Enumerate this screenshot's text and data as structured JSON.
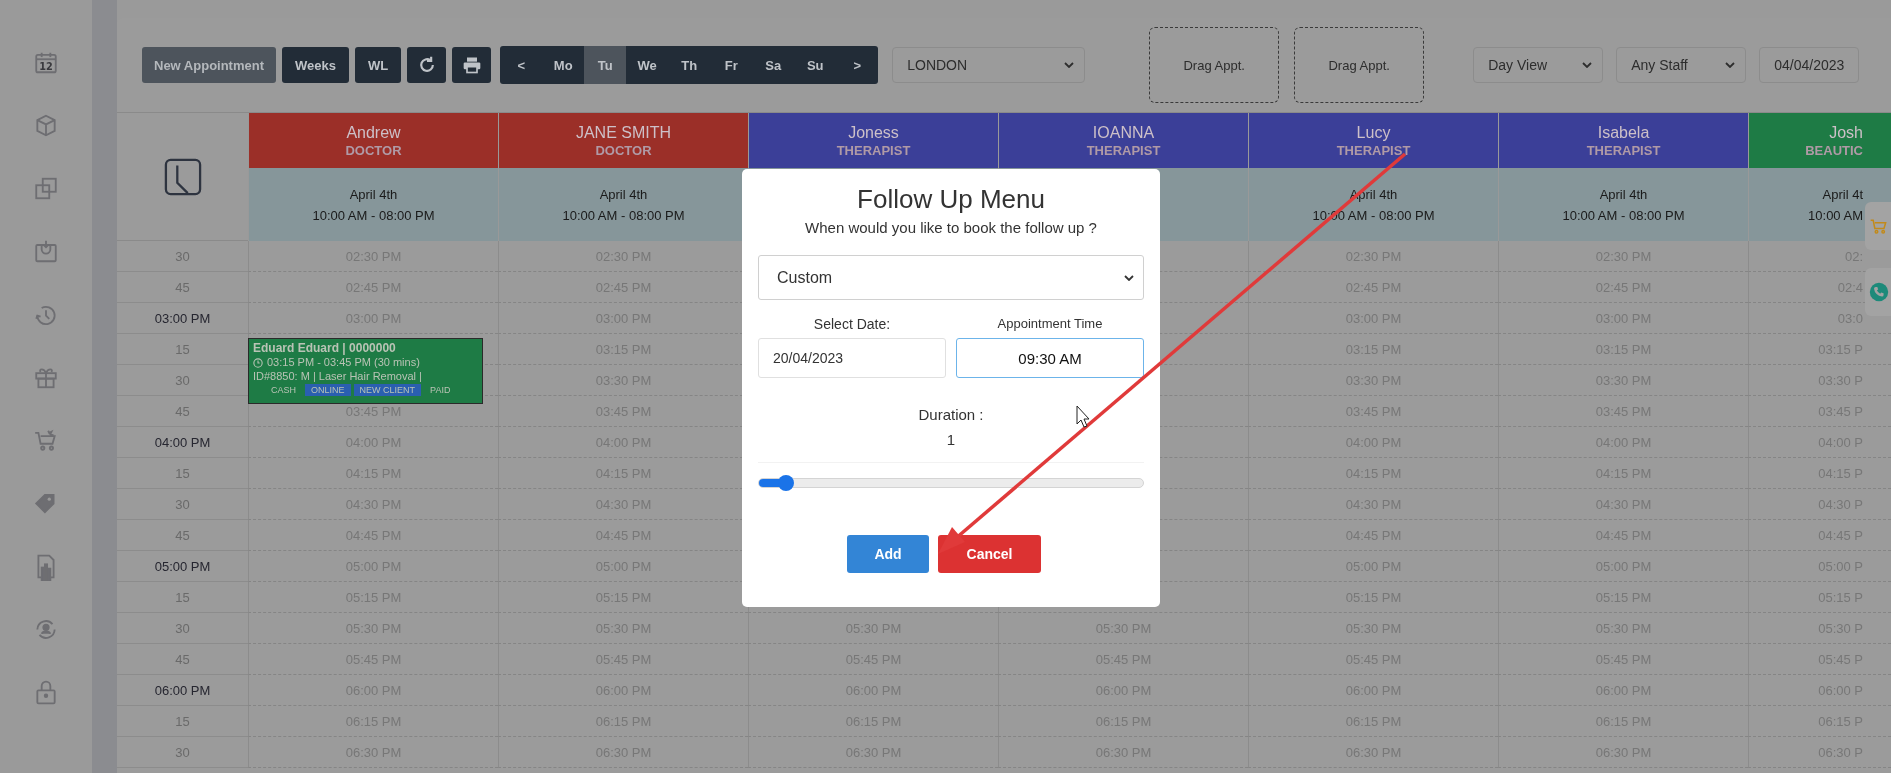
{
  "sidebar": {
    "calendar_day": "12"
  },
  "toolbar": {
    "buttons": [
      {
        "label": "New Appointment",
        "kind": "primary"
      },
      {
        "label": "Weeks",
        "kind": "dark"
      },
      {
        "label": "WL",
        "kind": "dark"
      },
      {
        "kind": "refresh"
      },
      {
        "kind": "print"
      }
    ],
    "day_nav": [
      {
        "label": "<",
        "selected": false
      },
      {
        "label": "Mo",
        "selected": false
      },
      {
        "label": "Tu",
        "selected": true
      },
      {
        "label": "We",
        "selected": false
      },
      {
        "label": "Th",
        "selected": false
      },
      {
        "label": "Fr",
        "selected": false
      },
      {
        "label": "Sa",
        "selected": false
      },
      {
        "label": "Su",
        "selected": false
      },
      {
        "label": ">",
        "selected": false
      }
    ],
    "location": {
      "value": "LONDON"
    },
    "drag_slots": [
      "Drag Appt.",
      "Drag Appt."
    ],
    "view_select": {
      "value": "Day View"
    },
    "staff_select": {
      "value": "Any Staff"
    },
    "date_field": {
      "value": "04/04/2023"
    }
  },
  "schedule": {
    "staff": [
      {
        "name": "Andrew",
        "role": "DOCTOR",
        "color": "#9b2f28",
        "date": "April 4th",
        "hours": "10:00 AM - 08:00 PM"
      },
      {
        "name": "JANE SMITH",
        "role": "DOCTOR",
        "color": "#9b2f28",
        "date": "April 4th",
        "hours": "10:00 AM - 08:00 PM"
      },
      {
        "name": "Joness",
        "role": "THERAPIST",
        "color": "#3b3f98"
      },
      {
        "name": "IOANNA",
        "role": "THERAPIST",
        "color": "#3b3f98"
      },
      {
        "name": "Lucy",
        "role": "THERAPIST",
        "color": "#3b3f98",
        "date": "April 4th",
        "hours": "10:00 AM - 08:00 PM"
      },
      {
        "name": "Isabela",
        "role": "THERAPIST",
        "color": "#3b3f98",
        "date": "April 4th",
        "hours": "10:00 AM - 08:00 PM"
      },
      {
        "name": "Josh",
        "role": "BEAUTIC",
        "color": "#1e7b45",
        "date": "April 4t",
        "hours": "10:00 AM"
      }
    ],
    "rows": [
      {
        "label": "30",
        "kind": "quarter",
        "cells": [
          "02:30 PM",
          "02:30 PM",
          null,
          null,
          "02:30 PM",
          "02:30 PM",
          "02:"
        ]
      },
      {
        "label": "45",
        "kind": "quarter",
        "cells": [
          "02:45 PM",
          "02:45 PM",
          null,
          null,
          "02:45 PM",
          "02:45 PM",
          "02:4"
        ]
      },
      {
        "label": "03:00 PM",
        "kind": "hour",
        "cells": [
          "03:00 PM",
          "03:00 PM",
          null,
          null,
          "03:00 PM",
          "03:00 PM",
          "03:0"
        ]
      },
      {
        "label": "15",
        "kind": "quarter",
        "cells": [
          null,
          "03:15 PM",
          null,
          null,
          "03:15 PM",
          "03:15 PM",
          "03:15 P"
        ]
      },
      {
        "label": "30",
        "kind": "quarter",
        "cells": [
          null,
          "03:30 PM",
          null,
          null,
          "03:30 PM",
          "03:30 PM",
          "03:30 P"
        ]
      },
      {
        "label": "45",
        "kind": "quarter",
        "cells": [
          "03:45 PM",
          "03:45 PM",
          null,
          null,
          "03:45 PM",
          "03:45 PM",
          "03:45 P"
        ]
      },
      {
        "label": "04:00 PM",
        "kind": "hour",
        "cells": [
          "04:00 PM",
          "04:00 PM",
          null,
          null,
          "04:00 PM",
          "04:00 PM",
          "04:00 P"
        ]
      },
      {
        "label": "15",
        "kind": "quarter",
        "cells": [
          "04:15 PM",
          "04:15 PM",
          null,
          null,
          "04:15 PM",
          "04:15 PM",
          "04:15 P"
        ]
      },
      {
        "label": "30",
        "kind": "quarter",
        "cells": [
          "04:30 PM",
          "04:30 PM",
          null,
          null,
          "04:30 PM",
          "04:30 PM",
          "04:30 P"
        ]
      },
      {
        "label": "45",
        "kind": "quarter",
        "cells": [
          "04:45 PM",
          "04:45 PM",
          null,
          null,
          "04:45 PM",
          "04:45 PM",
          "04:45 P"
        ]
      },
      {
        "label": "05:00 PM",
        "kind": "hour",
        "cells": [
          "05:00 PM",
          "05:00 PM",
          null,
          null,
          "05:00 PM",
          "05:00 PM",
          "05:00 P"
        ]
      },
      {
        "label": "15",
        "kind": "quarter",
        "cells": [
          "05:15 PM",
          "05:15 PM",
          null,
          null,
          "05:15 PM",
          "05:15 PM",
          "05:15 P"
        ]
      },
      {
        "label": "30",
        "kind": "quarter",
        "cells": [
          "05:30 PM",
          "05:30 PM",
          "05:30 PM",
          "05:30 PM",
          "05:30 PM",
          "05:30 PM",
          "05:30 P"
        ]
      },
      {
        "label": "45",
        "kind": "quarter",
        "cells": [
          "05:45 PM",
          "05:45 PM",
          "05:45 PM",
          "05:45 PM",
          "05:45 PM",
          "05:45 PM",
          "05:45 P"
        ]
      },
      {
        "label": "06:00 PM",
        "kind": "hour",
        "cells": [
          "06:00 PM",
          "06:00 PM",
          "06:00 PM",
          "06:00 PM",
          "06:00 PM",
          "06:00 PM",
          "06:00 P"
        ]
      },
      {
        "label": "15",
        "kind": "quarter",
        "cells": [
          "06:15 PM",
          "06:15 PM",
          "06:15 PM",
          "06:15 PM",
          "06:15 PM",
          "06:15 PM",
          "06:15 P"
        ]
      },
      {
        "label": "30",
        "kind": "quarter",
        "cells": [
          "06:30 PM",
          "06:30 PM",
          "06:30 PM",
          "06:30 PM",
          "06:30 PM",
          "06:30 PM",
          "06:30 P"
        ]
      }
    ],
    "appointment": {
      "title": "Eduard Eduard | 0000000",
      "time": "03:15 PM - 03:45 PM (30 mins)",
      "details": "ID#8850: M | Laser Hair Removal |",
      "tags": [
        {
          "label": "CASH",
          "color": "#1e7b45"
        },
        {
          "label": "ONLINE",
          "color": "#2a5fb0"
        },
        {
          "label": "NEW CLIENT",
          "color": "#2a5fb0"
        },
        {
          "label": "PAID",
          "color": "#1e7b45"
        }
      ]
    }
  },
  "modal": {
    "title": "Follow Up Menu",
    "prompt": "When would you like to book the follow up ?",
    "option": {
      "value": "Custom"
    },
    "date_label": "Select Date:",
    "date_value": "20/04/2023",
    "time_label": "Appointment Time",
    "time_value": "09:30 AM",
    "time_focused": true,
    "duration_label": "Duration :",
    "duration_value": "1",
    "duration_slider": {
      "level": 0.07
    },
    "buttons": [
      {
        "label": "Add",
        "kind": "confirm"
      },
      {
        "label": "Cancel",
        "kind": "cancel"
      }
    ]
  }
}
